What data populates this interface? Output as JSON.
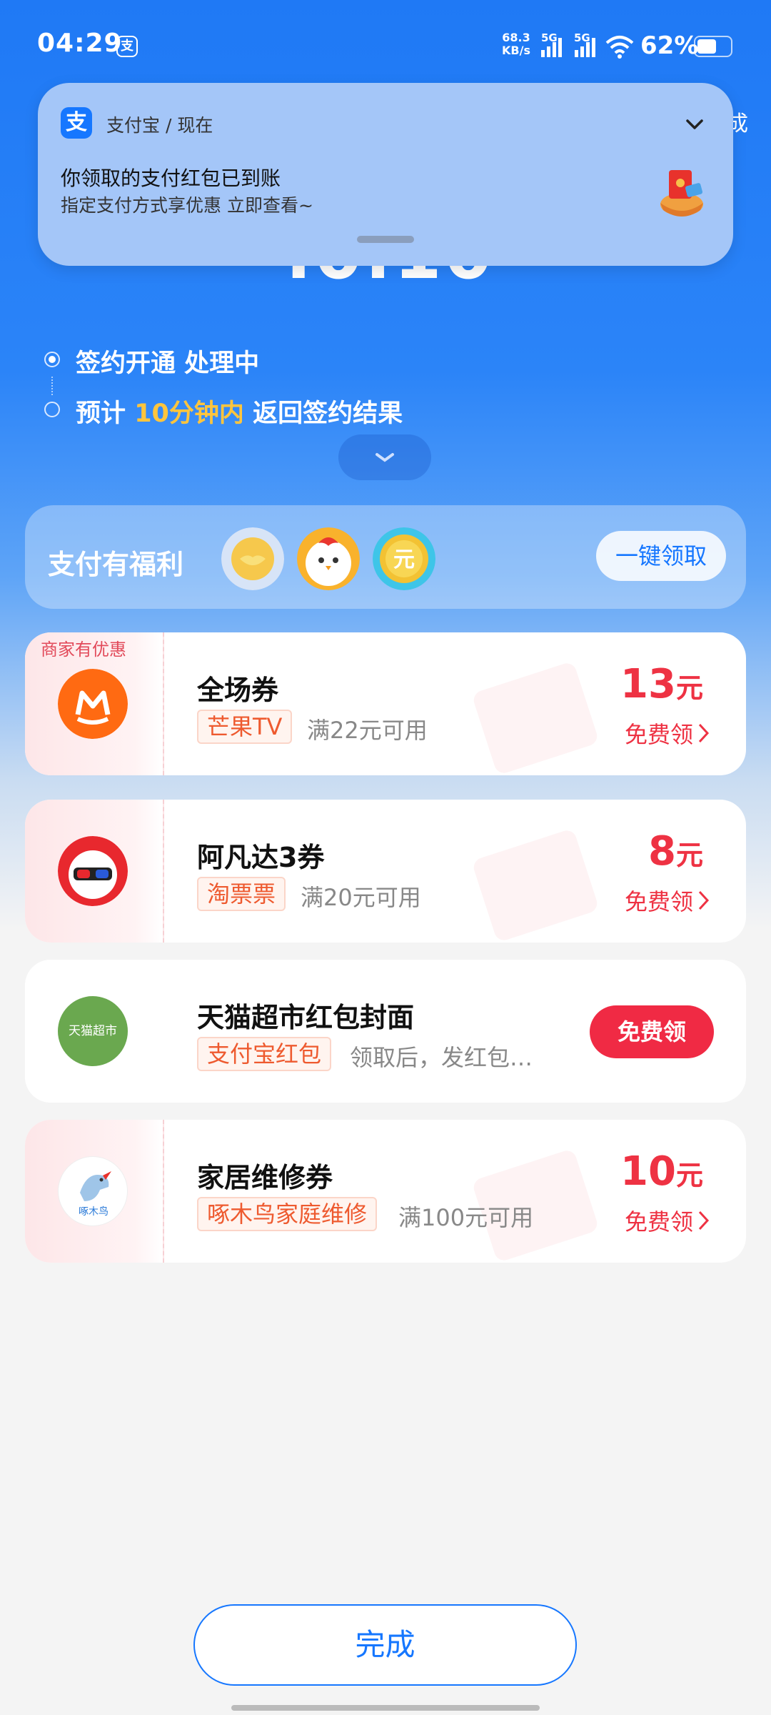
{
  "status_bar": {
    "time": "04:29",
    "alipay_glyph": "支",
    "net_speed_value": "68.3",
    "net_speed_unit": "KB/s",
    "sim1": "5G",
    "sim2": "5G",
    "battery": "62%",
    "battery_level": 0.62
  },
  "partially_hidden_text": "成",
  "amount_partial": ".0.10",
  "notification": {
    "app_icon_glyph": "支",
    "app": "支付宝 / 现在",
    "title": "你领取的支付红包已到账",
    "body": "指定支付方式享优惠  立即查看~"
  },
  "progress": {
    "step1": "签约开通 处理中",
    "step2_prefix": "预计 ",
    "step2_highlight": "10分钟内",
    "step2_suffix": " 返回签约结果"
  },
  "benefit": {
    "title": "支付有福利",
    "claim_all": "一键领取",
    "coin3_glyph": "元"
  },
  "coupons": [
    {
      "merchant_tag": "商家有优惠",
      "title": "全场券",
      "tag": "芒果TV",
      "condition": "满22元可用",
      "amount": "13",
      "unit": "元",
      "action": "免费领"
    },
    {
      "title": "阿凡达3券",
      "tag": "淘票票",
      "condition": "满20元可用",
      "amount": "8",
      "unit": "元",
      "action": "免费领"
    },
    {
      "title": "天猫超市红包封面",
      "tag": "支付宝红包",
      "condition": "领取后，发红包…",
      "logo_text": "天猫超市",
      "button": "免费领"
    },
    {
      "title": "家居维修券",
      "tag": "啄木鸟家庭维修",
      "condition": "满100元可用",
      "logo_text": "啄木鸟",
      "amount": "10",
      "unit": "元",
      "action": "免费领"
    }
  ],
  "done_button": "完成",
  "colors": {
    "primary": "#1677ff",
    "accent_red": "#ee3243",
    "highlight": "#ffc53d"
  }
}
